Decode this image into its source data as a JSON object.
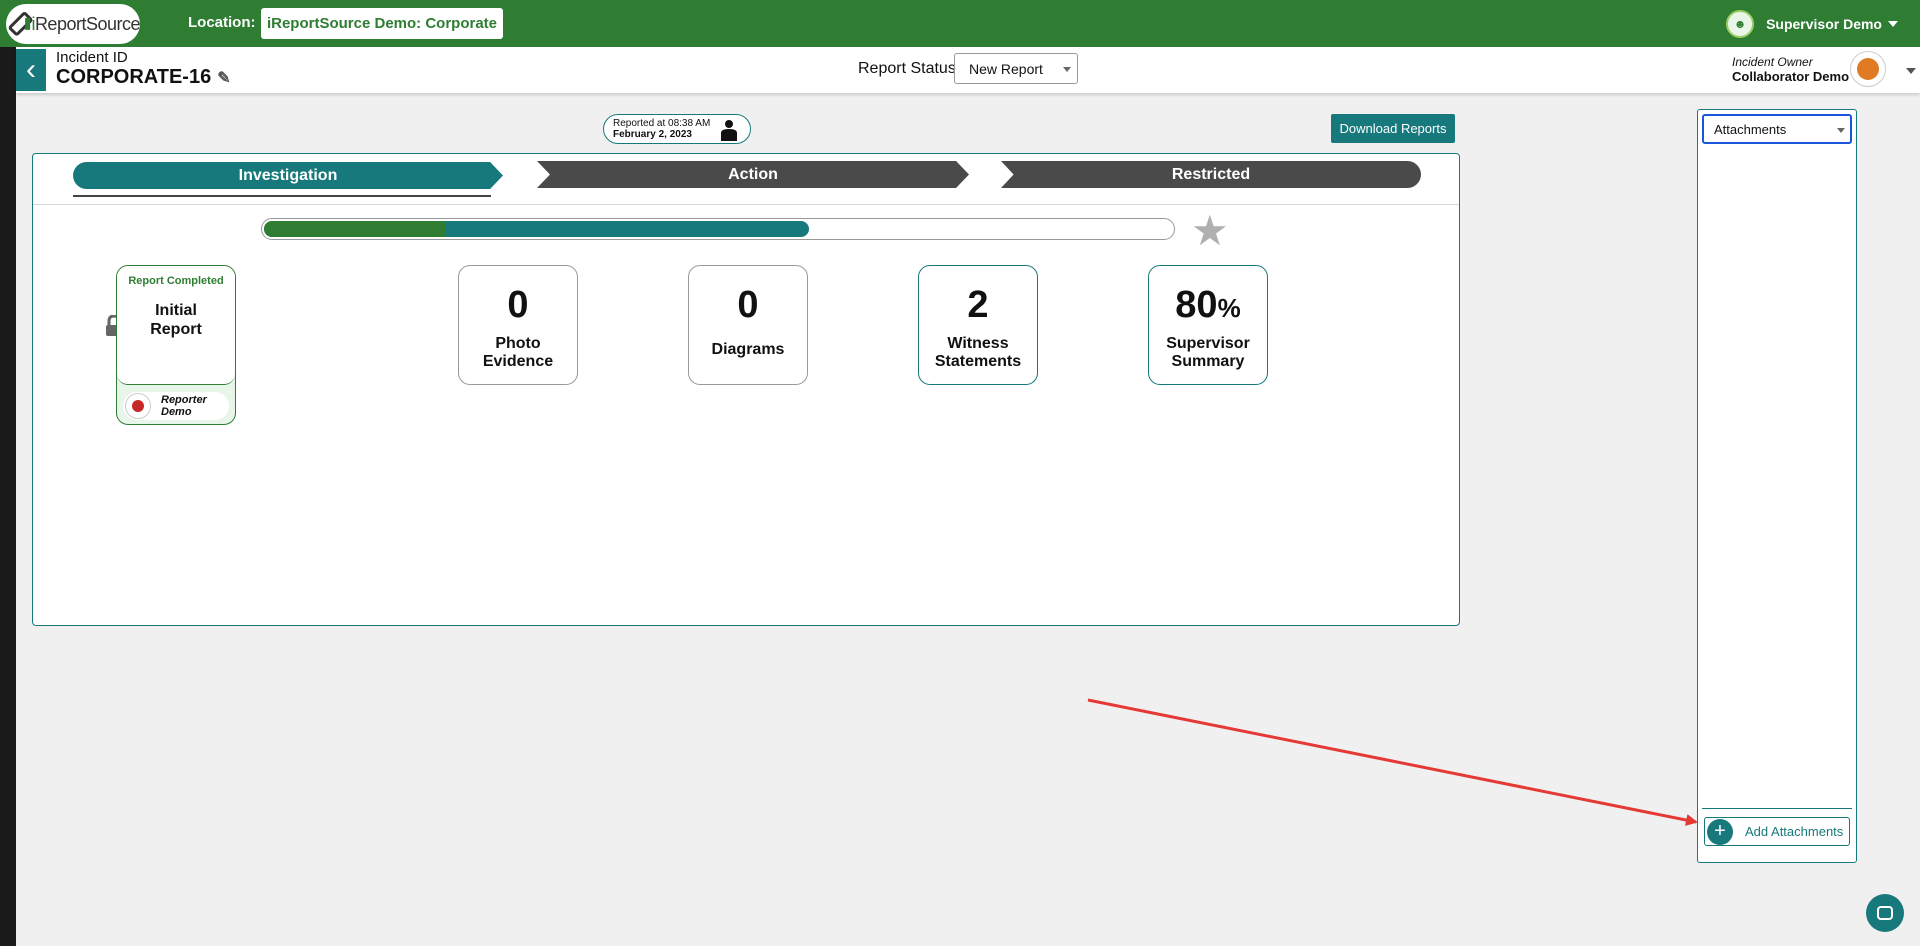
{
  "topbar": {
    "logo_text_prefix": "i",
    "logo_text_rest": "ReportSource",
    "location_label": "Location:",
    "location_value": "iReportSource Demo: Corporate",
    "user_name": "Supervisor Demo"
  },
  "header": {
    "incident_label": "Incident ID",
    "incident_id": "CORPORATE-16",
    "status_label": "Report Status:",
    "status_value": "New Report",
    "owner_label": "Incident Owner",
    "owner_name": "Collaborator Demo"
  },
  "reported": {
    "line1": "Reported at 08:38 AM",
    "line2": "February 2, 2023"
  },
  "download_label": "Download Reports",
  "tabs": [
    {
      "label": "Investigation",
      "active": true
    },
    {
      "label": "Action",
      "active": false
    },
    {
      "label": "Restricted",
      "active": false
    }
  ],
  "progress": {
    "green_fraction": 0.2,
    "total_fraction": 0.6
  },
  "initial_report": {
    "status": "Report Completed",
    "title_line1": "Initial",
    "title_line2": "Report",
    "reporter_line1": "Reporter",
    "reporter_line2": "Demo"
  },
  "cards": [
    {
      "value": "0",
      "suffix": "",
      "label_line1": "Photo",
      "label_line2": "Evidence"
    },
    {
      "value": "0",
      "suffix": "",
      "label_line1": "Diagrams",
      "label_line2": ""
    },
    {
      "value": "2",
      "suffix": "",
      "label_line1": "Witness",
      "label_line2": "Statements"
    },
    {
      "value": "80",
      "suffix": "%",
      "label_line1": "Supervisor",
      "label_line2": "Summary"
    }
  ],
  "attachments": {
    "select_value": "Attachments",
    "add_label": "Add Attachments"
  },
  "colors": {
    "brand_green": "#2e7d32",
    "teal": "#17797c",
    "dark_tab": "#4a4a4a",
    "annotation_arrow": "#e53935"
  }
}
